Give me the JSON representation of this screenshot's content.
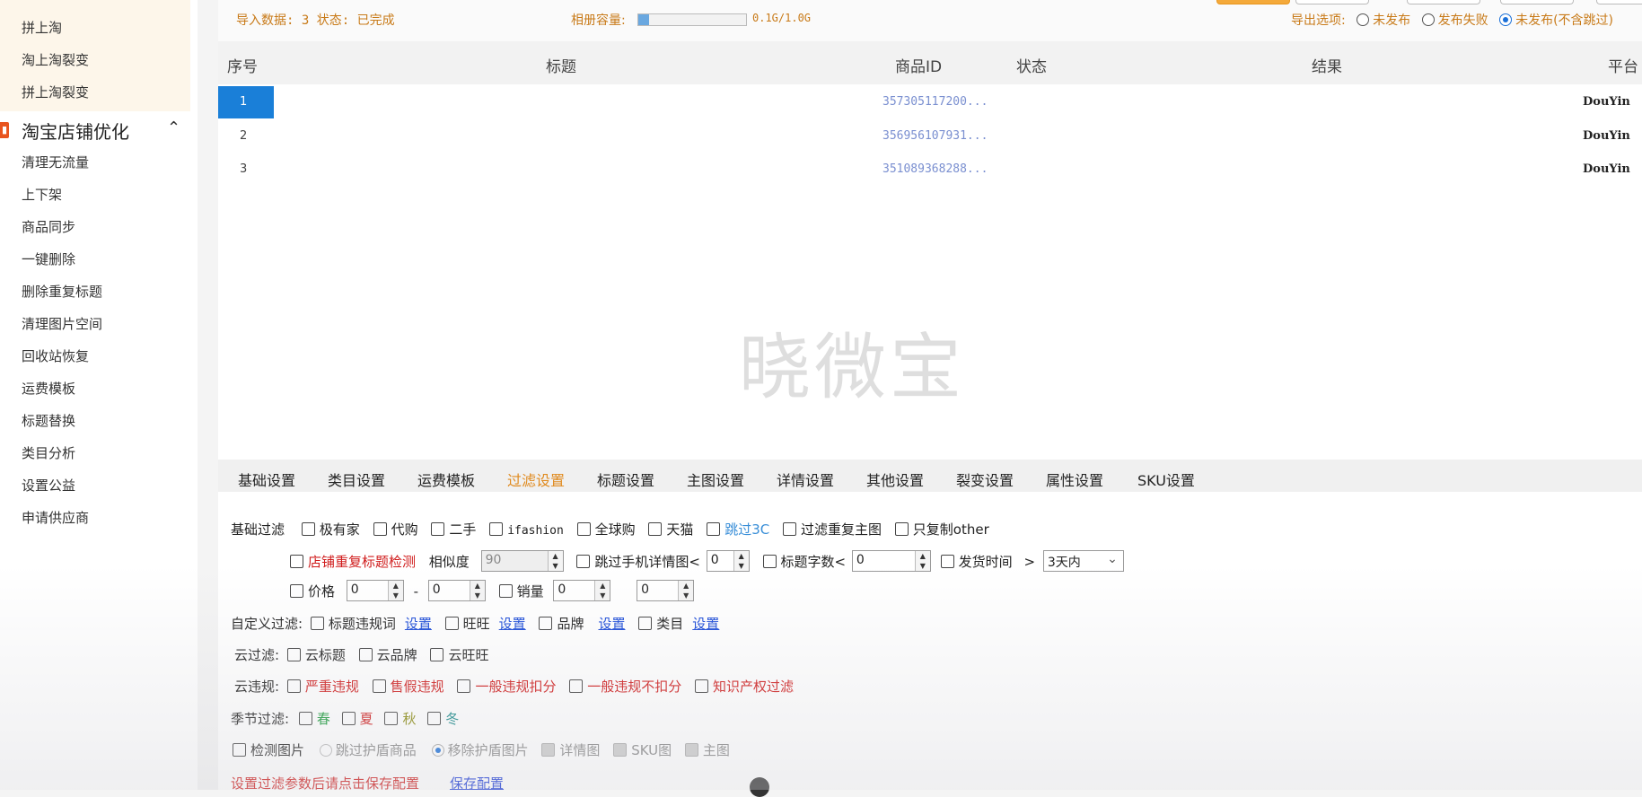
{
  "sidebar": {
    "items_top": [
      "拼上淘",
      "淘上淘裂变",
      "拼上淘裂变"
    ],
    "section_title": "淘宝店铺优化",
    "items": [
      "清理无流量",
      "上下架",
      "商品同步",
      "一键删除",
      "删除重复标题",
      "清理图片空间",
      "回收站恢复",
      "运费模板",
      "标题替换",
      "类目分析",
      "设置公益",
      "申请供应商"
    ]
  },
  "topbar": {
    "import_status": "导入数据: 3 状态: 已完成",
    "album_label": "相册容量:",
    "album_capacity": "0.1G/1.0G",
    "album_fill_pct": 10,
    "export_label": "导出选项:",
    "export_options": [
      "未发布",
      "发布失败",
      "未发布(不含跳过)"
    ],
    "export_selected": 2
  },
  "table": {
    "headers": [
      "序号",
      "标题",
      "商品ID",
      "状态",
      "结果",
      "平台"
    ],
    "rows": [
      {
        "index": "1",
        "title": "",
        "product_id": "357305117200...",
        "status": "",
        "result": "",
        "platform": "DouYin"
      },
      {
        "index": "2",
        "title": "",
        "product_id": "356956107931...",
        "status": "",
        "result": "",
        "platform": "DouYin"
      },
      {
        "index": "3",
        "title": "",
        "product_id": "351089368288...",
        "status": "",
        "result": "",
        "platform": "DouYin"
      }
    ]
  },
  "watermark": "晓微宝",
  "tabs": [
    "基础设置",
    "类目设置",
    "运费模板",
    "过滤设置",
    "标题设置",
    "主图设置",
    "详情设置",
    "其他设置",
    "裂变设置",
    "属性设置",
    "SKU设置"
  ],
  "active_tab": 3,
  "filters": {
    "basic_label": "基础过滤",
    "basic": [
      "极有家",
      "代购",
      "二手",
      "ifashion",
      "全球购",
      "天猫",
      "跳过3C",
      "过滤重复主图",
      "只复制other"
    ],
    "dup_title": "店铺重复标题检测",
    "similarity_label": "相似度",
    "similarity_value": "90",
    "skip_phone": "跳过手机详情图<",
    "skip_phone_value": "0",
    "title_len": "标题字数<",
    "title_len_value": "0",
    "ship_time": "发货时间",
    "ship_op": ">",
    "ship_value": "3天内",
    "price": "价格",
    "price_min": "0",
    "dash": "-",
    "price_max": "0",
    "sales": "销量",
    "sales_min": "0",
    "sales_max": "0",
    "custom_label": "自定义过滤:",
    "custom": [
      "标题违规词",
      "旺旺",
      "品牌",
      "类目"
    ],
    "settings_link": "设置",
    "cloud_label": "云过滤:",
    "cloud": [
      "云标题",
      "云品牌",
      "云旺旺"
    ],
    "violation_label": "云违规:",
    "violations": [
      "严重违规",
      "售假违规",
      "一般违规扣分",
      "一般违规不扣分",
      "知识产权过滤"
    ],
    "season_label": "季节过滤:",
    "seasons": [
      "春",
      "夏",
      "秋",
      "冬"
    ],
    "image_check": "检测图片",
    "image_opts": [
      "跳过护盾商品",
      "移除护盾图片",
      "详情图",
      "SKU图",
      "主图"
    ],
    "save_tip": "设置过滤参数后请点击保存配置",
    "save_link": "保存配置"
  }
}
